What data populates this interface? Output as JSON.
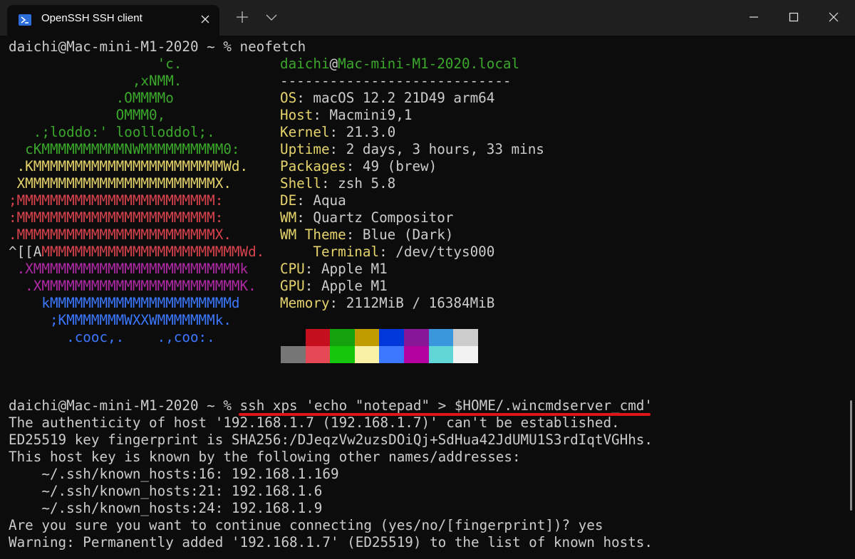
{
  "window": {
    "tab_title": "OpenSSH SSH client",
    "icons": [
      "powershell-icon",
      "close-icon",
      "plus-icon",
      "chevron-down-icon",
      "minimize-icon",
      "maximize-icon",
      "close-icon"
    ]
  },
  "terminal": {
    "prompt_line": "daichi@Mac-mini-M1-2020 ~ % neofetch",
    "logo_lines": [
      {
        "text": "                  'c.",
        "color": "#3aa82a"
      },
      {
        "text": "               ,xNMM.",
        "color": "#3aa82a"
      },
      {
        "text": "             .OMMMMo",
        "color": "#3aa82a"
      },
      {
        "text": "             OMMM0,",
        "color": "#3aa82a"
      },
      {
        "text": "   .;loddo:' loolloddol;.",
        "color": "#3aa82a"
      },
      {
        "text": "  cKMMMMMMMMMMNWMMMMMMMMMM0:",
        "color": "#3aa82a"
      },
      {
        "text": " .KMMMMMMMMMMMMMMMMMMMMMMMWd.",
        "color": "#e5d36b"
      },
      {
        "text": " XMMMMMMMMMMMMMMMMMMMMMMMX.",
        "color": "#e5d36b"
      },
      {
        "text": ";MMMMMMMMMMMMMMMMMMMMMMMM:",
        "color": "#d9434d"
      },
      {
        "text": ":MMMMMMMMMMMMMMMMMMMMMMMM:",
        "color": "#d9434d"
      },
      {
        "text": ".MMMMMMMMMMMMMMMMMMMMMMMMX.",
        "color": "#d9434d"
      },
      {
        "text": " .XMMMMMMMMMMMMMMMMMMMMMMMMMk",
        "color": "#b02aa6"
      },
      {
        "text": "  .XMMMMMMMMMMMMMMMMMMMMMMMMK.",
        "color": "#b02aa6"
      },
      {
        "text": "    kMMMMMMMMMMMMMMMMMMMMMMd",
        "color": "#3b78ff"
      },
      {
        "text": "     ;KMMMMMMMWXXWMMMMMMMk.",
        "color": "#3b78ff"
      },
      {
        "text": "       .cooc,.    .,coo:.",
        "color": "#3b78ff"
      }
    ],
    "logo_line12_prefix": "^[[A",
    "logo_line12_rest": "MMMMMMMMMMMMMMMMMMMMMMMMWd.",
    "user_host": {
      "user": "daichi",
      "at": "@",
      "host": "Mac-mini-M1-2020.local"
    },
    "separator": "----------------------------",
    "info": [
      {
        "key": "OS",
        "value": "macOS 12.2 21D49 arm64"
      },
      {
        "key": "Host",
        "value": "Macmini9,1"
      },
      {
        "key": "Kernel",
        "value": "21.3.0"
      },
      {
        "key": "Uptime",
        "value": "2 days, 3 hours, 33 mins"
      },
      {
        "key": "Packages",
        "value": "49 (brew)"
      },
      {
        "key": "Shell",
        "value": "zsh 5.8"
      },
      {
        "key": "DE",
        "value": "Aqua"
      },
      {
        "key": "WM",
        "value": "Quartz Compositor"
      },
      {
        "key": "WM Theme",
        "value": "Blue (Dark)"
      },
      {
        "key": "    Terminal",
        "value": "/dev/ttys000"
      },
      {
        "key": "CPU",
        "value": "Apple M1"
      },
      {
        "key": "GPU",
        "value": "Apple M1"
      },
      {
        "key": "Memory",
        "value": "2112MiB / 16384MiB"
      }
    ],
    "palette_top": [
      "#0c0c0c",
      "#c50f1f",
      "#13a10e",
      "#c19c00",
      "#0037da",
      "#881798",
      "#3a96dd",
      "#cccccc"
    ],
    "palette_bottom": [
      "#767676",
      "#e74856",
      "#16c60c",
      "#f9f1a5",
      "#3b78ff",
      "#b4009e",
      "#61d6d6",
      "#f2f2f2"
    ],
    "ssh_prompt": "daichi@Mac-mini-M1-2020 ~ % ",
    "ssh_command": "ssh xps 'echo \"notepad\" > $HOME/.wincmdserver_cmd'",
    "output_lines": [
      "The authenticity of host '192.168.1.7 (192.168.1.7)' can't be established.",
      "ED25519 key fingerprint is SHA256:/DJeqzVw2uzsDOiQj+SdHua42JdUMU1S3rdIqtVGHhs.",
      "This host key is known by the following other names/addresses:",
      "    ~/.ssh/known_hosts:16: 192.168.1.169",
      "    ~/.ssh/known_hosts:21: 192.168.1.6",
      "    ~/.ssh/known_hosts:24: 192.168.1.9",
      "Are you sure you want to continue connecting (yes/no/[fingerprint])? yes",
      "Warning: Permanently added '192.168.1.7' (ED25519) to the list of known hosts."
    ],
    "colors": {
      "green": "#3aa82a",
      "key": "#e5d36b",
      "text": "#cccccc",
      "underline": "#e0151b"
    }
  }
}
